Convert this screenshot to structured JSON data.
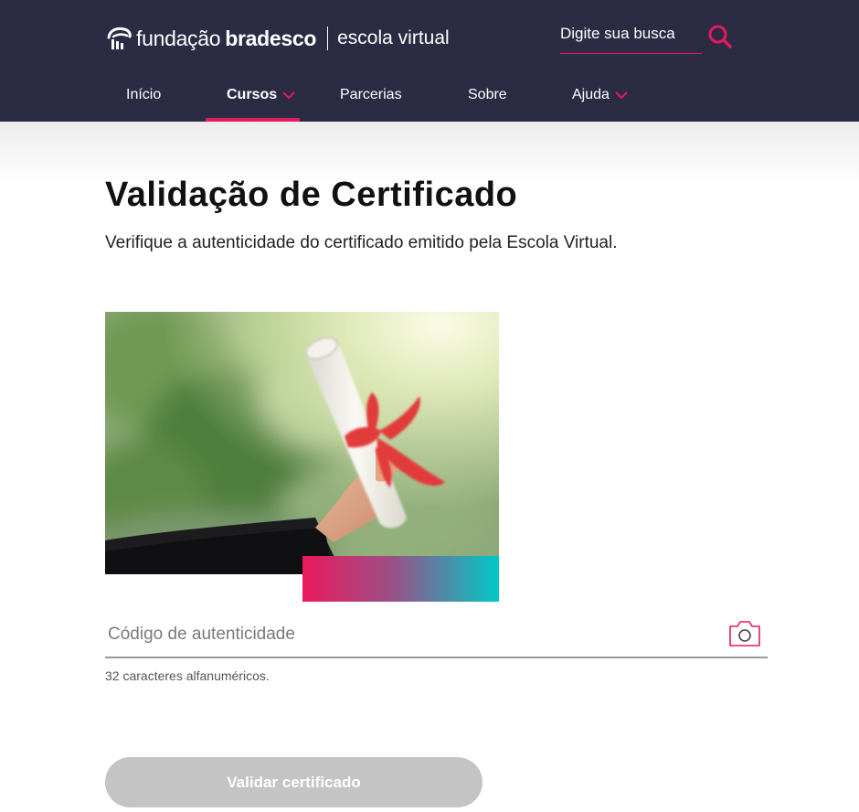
{
  "header": {
    "logo": {
      "fundacao": "fundação",
      "bradesco": "bradesco",
      "escola": "escola virtual"
    },
    "search": {
      "label": "Digite sua busca"
    },
    "nav": [
      {
        "label": "Início",
        "active": false
      },
      {
        "label": "Cursos",
        "active": true,
        "has_dropdown": true
      },
      {
        "label": "Parcerias",
        "active": false
      },
      {
        "label": "Sobre",
        "active": false
      },
      {
        "label": "Ajuda",
        "active": false,
        "has_dropdown": true
      }
    ]
  },
  "main": {
    "title": "Validação de Certificado",
    "subtitle": "Verifique a autenticidade do certificado emitido pela Escola Virtual.",
    "code_field": {
      "placeholder": "Código de autenticidade",
      "value": "",
      "hint": "32 caracteres alfanuméricos."
    },
    "submit_label": "Validar certificado"
  },
  "colors": {
    "header_bg": "#2b2c44",
    "accent": "#e6195e",
    "teal": "#00c8c8",
    "button_disabled": "#c4c4c4"
  },
  "icons": [
    "logo-mark-icon",
    "search-icon",
    "chevron-down-icon",
    "camera-icon"
  ]
}
